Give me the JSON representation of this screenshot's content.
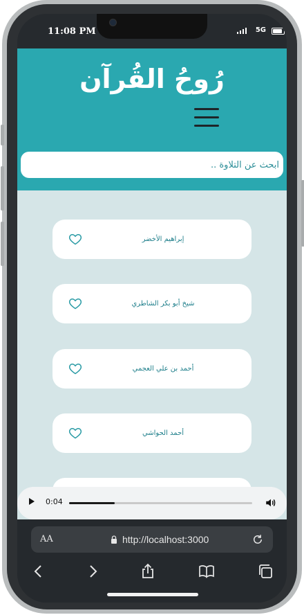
{
  "status_bar": {
    "time": "11:08 PM",
    "network": "5G"
  },
  "app": {
    "title": "رُوحُ القُرآن",
    "search_placeholder": "ابحث عن التلاوة ..",
    "colors": {
      "header": "#2aa8b0",
      "list_bg": "#d5e5e7",
      "text_accent": "#1f7f8b"
    }
  },
  "reciters": [
    {
      "name": "إبراهيم الأخضر",
      "icon": "heart-outline-icon"
    },
    {
      "name": "شيخ أبو بكر الشاطري",
      "icon": "heart-outline-icon"
    },
    {
      "name": "أحمد بن علي العجمي",
      "icon": "heart-outline-icon"
    },
    {
      "name": "أحمد الحواشي",
      "icon": "heart-outline-icon"
    },
    {
      "name": "",
      "icon": "heart-outline-icon"
    }
  ],
  "player": {
    "current_time": "0:04",
    "progress": 0.25
  },
  "browser": {
    "aa_label": "AA",
    "url": "http://localhost:3000"
  }
}
